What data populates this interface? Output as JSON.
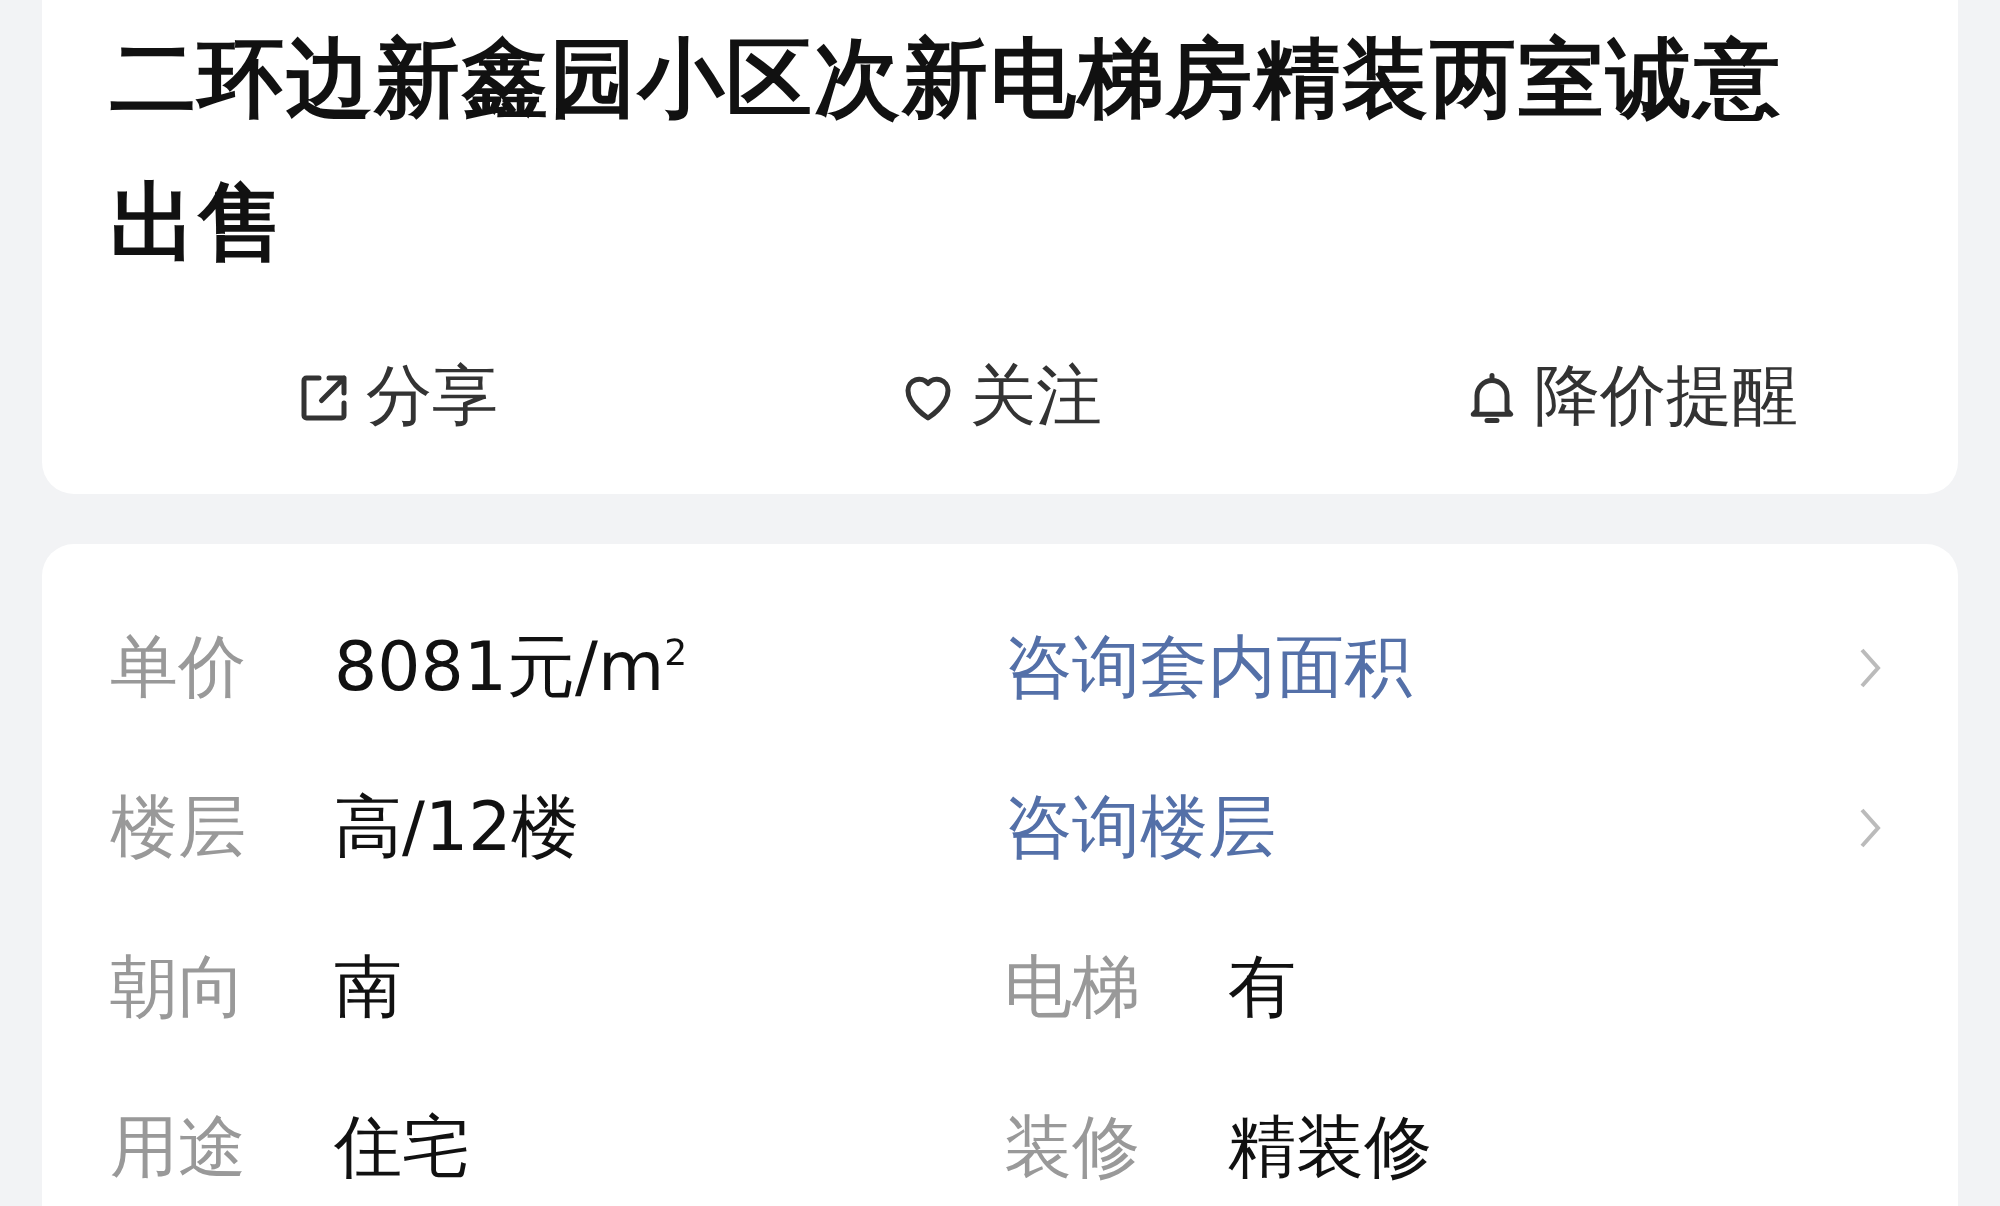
{
  "title": "二环边新鑫园小区次新电梯房精装两室诚意出售",
  "actions": [
    {
      "kind": "share",
      "label": "分享"
    },
    {
      "kind": "follow",
      "label": "关注"
    },
    {
      "kind": "alert",
      "label": "降价提醒"
    }
  ],
  "details": [
    [
      {
        "kind": "field",
        "label": "单价",
        "value": "8081元/m$^{2}$"
      },
      {
        "kind": "link",
        "text": "咨询套内面积"
      }
    ],
    [
      {
        "kind": "field",
        "label": "楼层",
        "value": "高/12楼"
      },
      {
        "kind": "link",
        "text": "咨询楼层"
      }
    ],
    [
      {
        "kind": "field",
        "label": "朝向",
        "value": "南"
      },
      {
        "kind": "field",
        "label": "电梯",
        "value": "有"
      }
    ],
    [
      {
        "kind": "field",
        "label": "用途",
        "value": "住宅"
      },
      {
        "kind": "field",
        "label": "装修",
        "value": "精装修"
      }
    ]
  ]
}
